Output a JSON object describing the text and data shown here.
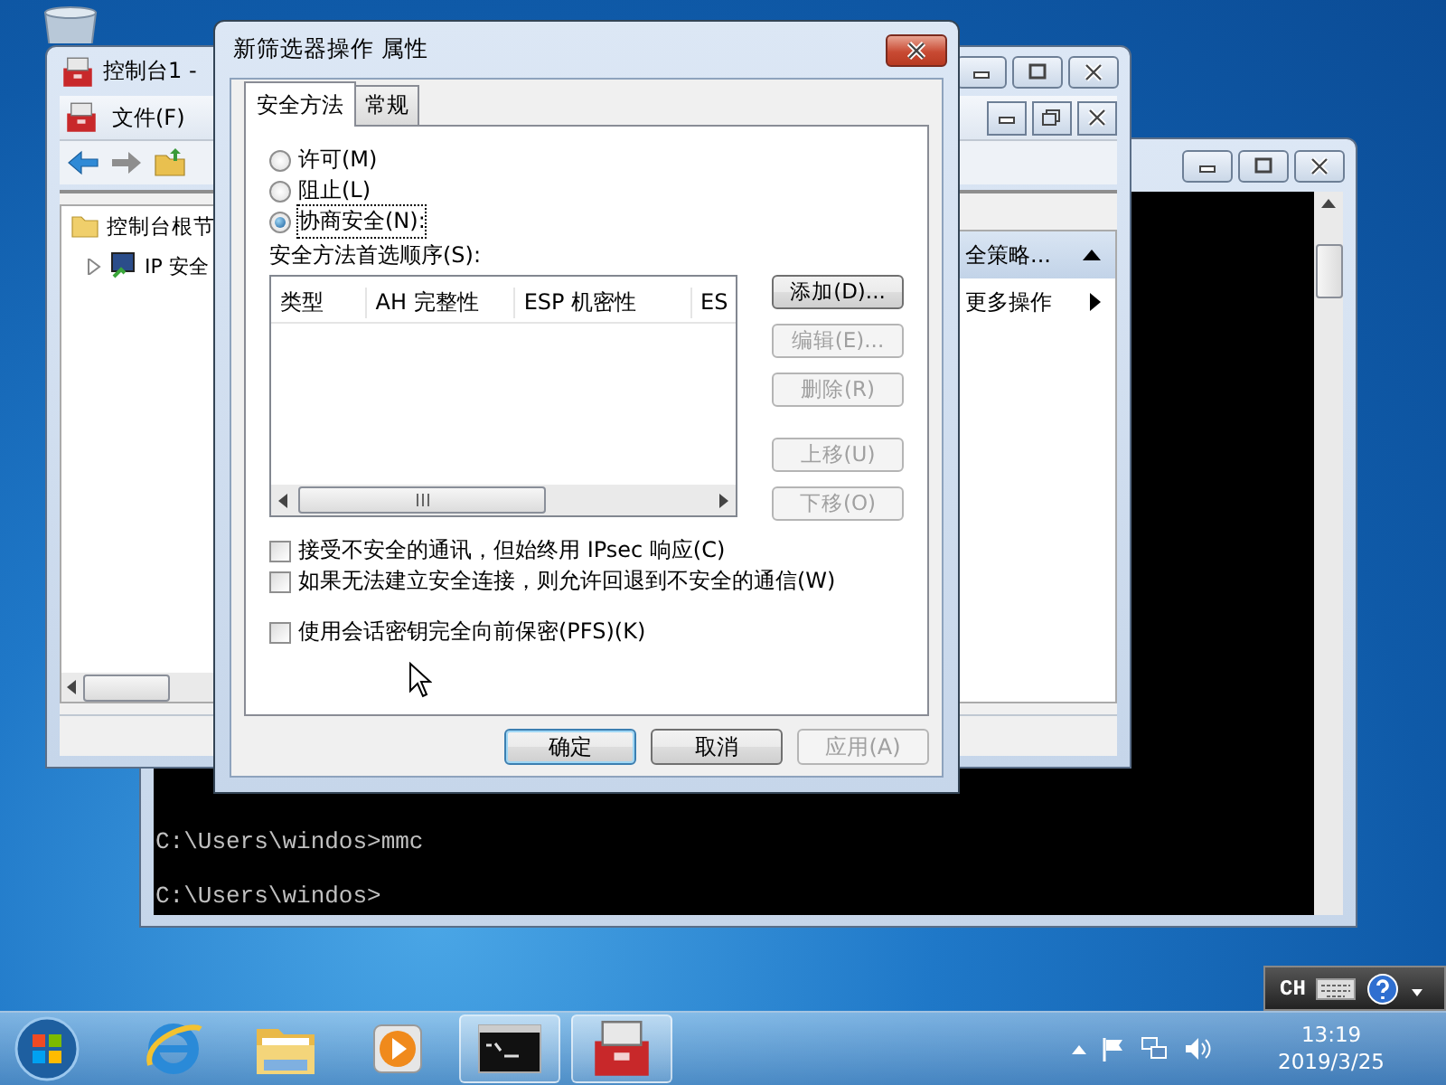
{
  "console_window": {
    "lines": [
      "C:\\Users\\windos>mmc",
      "C:\\Users\\windos>"
    ]
  },
  "mmc_window": {
    "title": "控制台1 -",
    "menu": [
      "文件(F)"
    ],
    "tree": [
      {
        "label": "控制台根节",
        "children": [
          {
            "label": "IP 安全",
            "expanded": false
          }
        ]
      }
    ],
    "actions": [
      {
        "kind": "header",
        "label": "全策略..."
      },
      {
        "kind": "submenu",
        "label": "更多操作"
      }
    ]
  },
  "dialog": {
    "title": "新筛选器操作 属性",
    "tabs": [
      {
        "label": "安全方法",
        "selected": true
      },
      {
        "label": "常规",
        "selected": false
      }
    ],
    "radios": [
      {
        "label": "许可(M)",
        "selected": false
      },
      {
        "label": "阻止(L)",
        "selected": false
      },
      {
        "label": "协商安全(N):",
        "selected": true
      }
    ],
    "list": {
      "label": "安全方法首选顺序(S):",
      "columns": [
        "类型",
        "AH 完整性",
        "ESP 机密性",
        "ES"
      ]
    },
    "side_buttons": [
      {
        "label": "添加(D)...",
        "disabled": false
      },
      {
        "label": "编辑(E)...",
        "disabled": true
      },
      {
        "label": "删除(R)",
        "disabled": true
      },
      {
        "label": "上移(U)",
        "disabled": true
      },
      {
        "label": "下移(O)",
        "disabled": true
      }
    ],
    "checkboxes": [
      {
        "label": "接受不安全的通讯，但始终用 IPsec 响应(C)",
        "checked": false
      },
      {
        "label": "如果无法建立安全连接，则允许回退到不安全的通信(W)",
        "checked": false
      },
      {
        "label": "使用会话密钥完全向前保密(PFS)(K)",
        "checked": false
      }
    ],
    "footer_buttons": [
      {
        "label": "确定",
        "disabled": false,
        "default": true
      },
      {
        "label": "取消",
        "disabled": false,
        "default": false
      },
      {
        "label": "应用(A)",
        "disabled": true,
        "default": false
      }
    ]
  },
  "language_bar": {
    "label": "CH"
  },
  "taskbar": {
    "items": [
      {
        "kind": "ie",
        "active": false
      },
      {
        "kind": "folder",
        "active": false
      },
      {
        "kind": "media",
        "active": false
      },
      {
        "kind": "console",
        "active": true
      },
      {
        "kind": "toolbox",
        "active": true
      }
    ],
    "clock": {
      "time": "13:19",
      "date": "2019/3/25"
    }
  }
}
